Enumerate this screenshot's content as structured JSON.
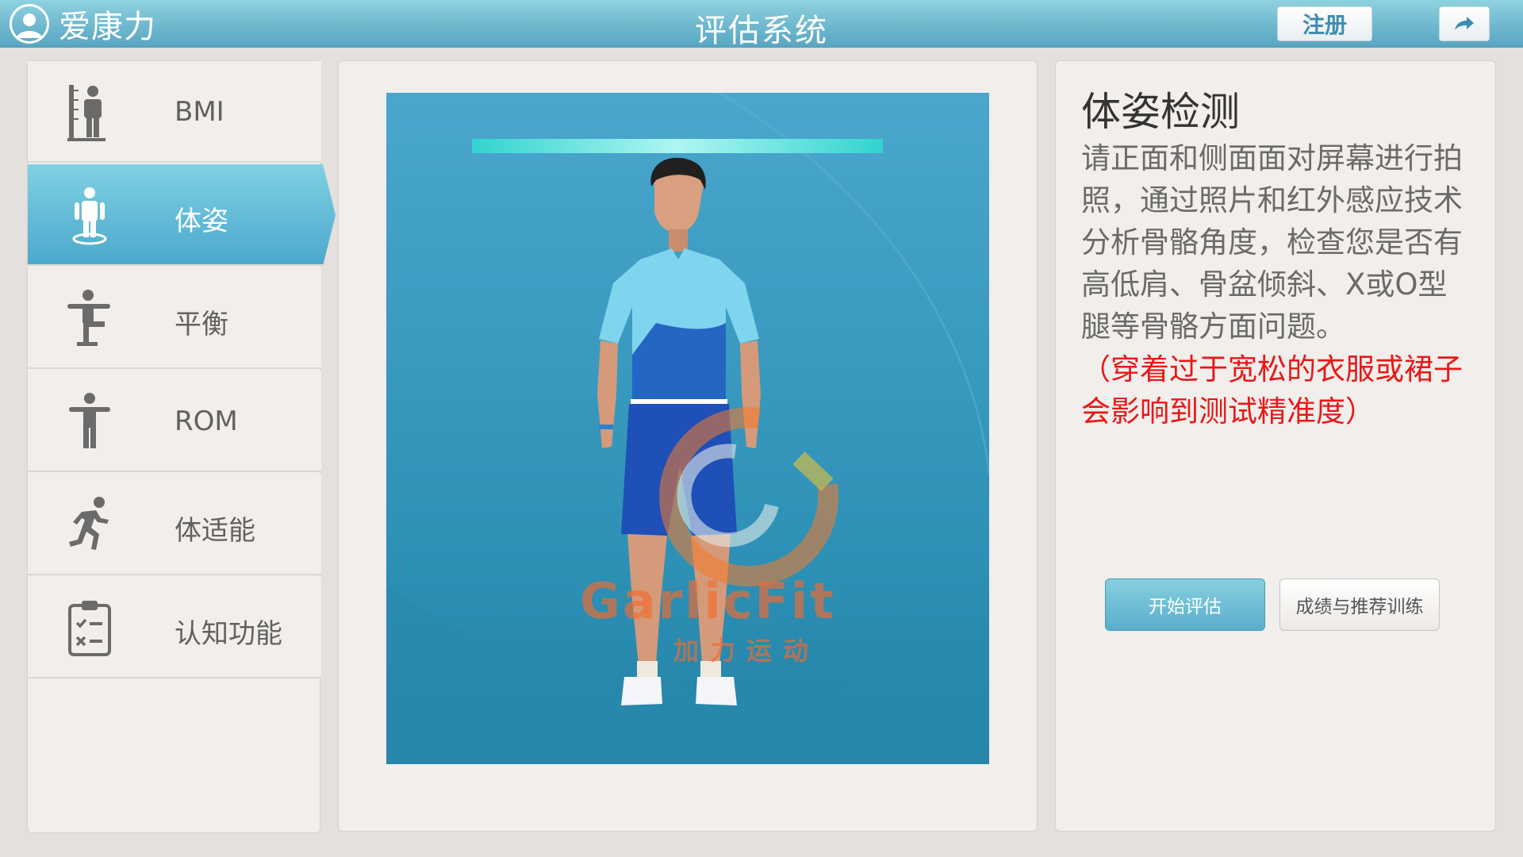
{
  "header": {
    "brand_name": "爱康力",
    "app_title": "评估系统",
    "register_label": "注册",
    "avatar_icon": "user-avatar-icon",
    "share_icon": "share-arrow-icon"
  },
  "sidebar": {
    "items": [
      {
        "label": "BMI",
        "icon": "height-scale-icon",
        "active": false
      },
      {
        "label": "体姿",
        "icon": "posture-icon",
        "active": true
      },
      {
        "label": "平衡",
        "icon": "balance-icon",
        "active": false
      },
      {
        "label": "ROM",
        "icon": "range-of-motion-icon",
        "active": false
      },
      {
        "label": "体适能",
        "icon": "running-icon",
        "active": false
      },
      {
        "label": "认知功能",
        "icon": "checklist-icon",
        "active": false
      }
    ]
  },
  "stage": {
    "figure": "standing-athlete-figure",
    "watermark_logo": "garlicfit-logo",
    "watermark_text": "GarlicFit",
    "watermark_subtext": "加力运动"
  },
  "info": {
    "title": "体姿检测",
    "description": "请正面和侧面面对屏幕进行拍照，通过照片和红外感应技术分析骨骼角度，检查您是否有高低肩、骨盆倾斜、X或O型腿等骨骼方面问题。",
    "note": "（穿着过于宽松的衣服或裙子会影响到测试精准度）",
    "start_button": "开始评估",
    "results_button": "成绩与推荐训练"
  },
  "colors": {
    "accent": "#5aaecb",
    "header": "#6fb8cf",
    "warning": "#e81818",
    "panel": "#f1eeeb"
  }
}
